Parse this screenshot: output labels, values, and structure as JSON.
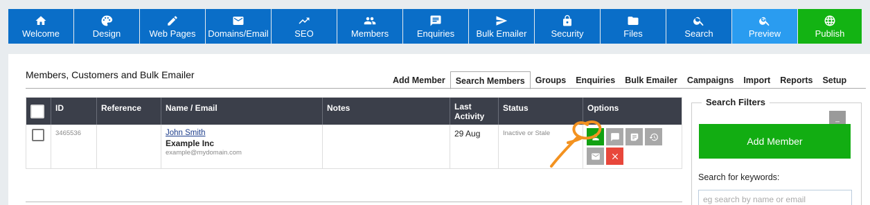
{
  "nav": [
    {
      "label": "Welcome",
      "icon": "home-icon"
    },
    {
      "label": "Design",
      "icon": "palette-icon"
    },
    {
      "label": "Web Pages",
      "icon": "pencil-icon"
    },
    {
      "label": "Domains/Email",
      "icon": "envelope-icon"
    },
    {
      "label": "SEO",
      "icon": "trending-icon"
    },
    {
      "label": "Members",
      "icon": "people-icon"
    },
    {
      "label": "Enquiries",
      "icon": "chat-icon"
    },
    {
      "label": "Bulk Emailer",
      "icon": "send-icon"
    },
    {
      "label": "Security",
      "icon": "lock-icon"
    },
    {
      "label": "Files",
      "icon": "folder-icon"
    },
    {
      "label": "Search",
      "icon": "search-icon"
    },
    {
      "label": "Preview",
      "icon": "zoom-icon"
    },
    {
      "label": "Publish",
      "icon": "globe-icon"
    }
  ],
  "page_title": "Members, Customers and Bulk Emailer",
  "tabs": [
    "Add Member",
    "Search Members",
    "Groups",
    "Enquiries",
    "Bulk Emailer",
    "Campaigns",
    "Import",
    "Reports",
    "Setup"
  ],
  "active_tab": "Search Members",
  "table": {
    "headers": [
      "ID",
      "Reference",
      "Name / Email",
      "Notes",
      "Last Activity",
      "Status",
      "Options"
    ],
    "rows": [
      {
        "id": "3465536",
        "reference": "",
        "name": "John Smith",
        "company": "Example Inc",
        "email": "example@mydomain.com",
        "notes": "",
        "last_activity": "29 Aug",
        "status": "Inactive or Stale"
      }
    ]
  },
  "filters": {
    "title": "Search Filters",
    "minimize": "_",
    "add_member": "Add Member",
    "keywords_label": "Search for keywords:",
    "keywords_placeholder": "eg search by name or email"
  },
  "colors": {
    "nav_blue": "#0a6ec8",
    "preview_blue": "#2a9cf0",
    "publish_green": "#13b313",
    "annotation_orange": "#f39220"
  }
}
